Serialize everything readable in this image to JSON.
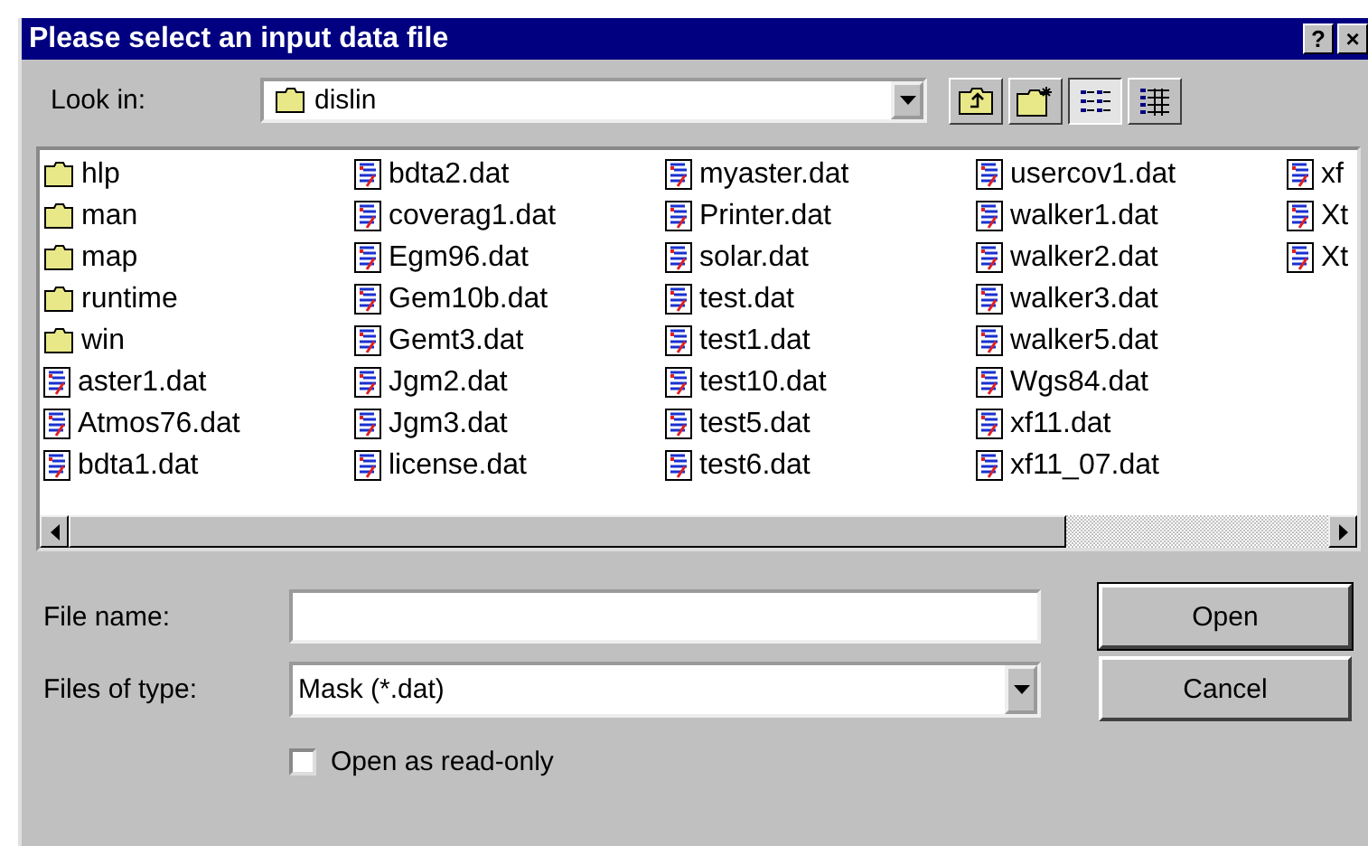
{
  "window": {
    "title": "Please select an input data file",
    "buttons": [
      "?",
      "×"
    ]
  },
  "look_in": {
    "label": "Look in:",
    "value": "dislin"
  },
  "views": [
    {
      "kind": "list",
      "selected": true
    },
    {
      "kind": "details",
      "selected": false
    }
  ],
  "files": [
    [
      {
        "name": "hlp",
        "kind": "folder"
      },
      {
        "name": "man",
        "kind": "folder"
      },
      {
        "name": "map",
        "kind": "folder"
      },
      {
        "name": "runtime",
        "kind": "folder"
      },
      {
        "name": "win",
        "kind": "folder"
      },
      {
        "name": "aster1.dat",
        "kind": "file"
      },
      {
        "name": "Atmos76.dat",
        "kind": "file"
      },
      {
        "name": "bdta1.dat",
        "kind": "file"
      }
    ],
    [
      {
        "name": "bdta2.dat",
        "kind": "file"
      },
      {
        "name": "coverag1.dat",
        "kind": "file"
      },
      {
        "name": "Egm96.dat",
        "kind": "file"
      },
      {
        "name": "Gem10b.dat",
        "kind": "file"
      },
      {
        "name": "Gemt3.dat",
        "kind": "file"
      },
      {
        "name": "Jgm2.dat",
        "kind": "file"
      },
      {
        "name": "Jgm3.dat",
        "kind": "file"
      },
      {
        "name": "license.dat",
        "kind": "file"
      }
    ],
    [
      {
        "name": "myaster.dat",
        "kind": "file"
      },
      {
        "name": "Printer.dat",
        "kind": "file"
      },
      {
        "name": "solar.dat",
        "kind": "file"
      },
      {
        "name": "test.dat",
        "kind": "file"
      },
      {
        "name": "test1.dat",
        "kind": "file"
      },
      {
        "name": "test10.dat",
        "kind": "file"
      },
      {
        "name": "test5.dat",
        "kind": "file"
      },
      {
        "name": "test6.dat",
        "kind": "file"
      }
    ],
    [
      {
        "name": "usercov1.dat",
        "kind": "file"
      },
      {
        "name": "walker1.dat",
        "kind": "file"
      },
      {
        "name": "walker2.dat",
        "kind": "file"
      },
      {
        "name": "walker3.dat",
        "kind": "file"
      },
      {
        "name": "walker5.dat",
        "kind": "file"
      },
      {
        "name": "Wgs84.dat",
        "kind": "file"
      },
      {
        "name": "xf11.dat",
        "kind": "file"
      },
      {
        "name": "xf11_07.dat",
        "kind": "file"
      }
    ],
    [
      {
        "name": "xf",
        "kind": "file"
      },
      {
        "name": "Xt",
        "kind": "file"
      },
      {
        "name": "Xt",
        "kind": "file"
      }
    ]
  ],
  "file_name": {
    "label": "File name:"
  },
  "file_type": {
    "label": "Files of type:",
    "value": "Mask (*.dat)"
  },
  "read_only": {
    "label": "Open as read-only",
    "checked": false
  },
  "buttons": [
    {
      "label": "Open",
      "default": true
    },
    {
      "label": "Cancel",
      "default": false
    }
  ]
}
